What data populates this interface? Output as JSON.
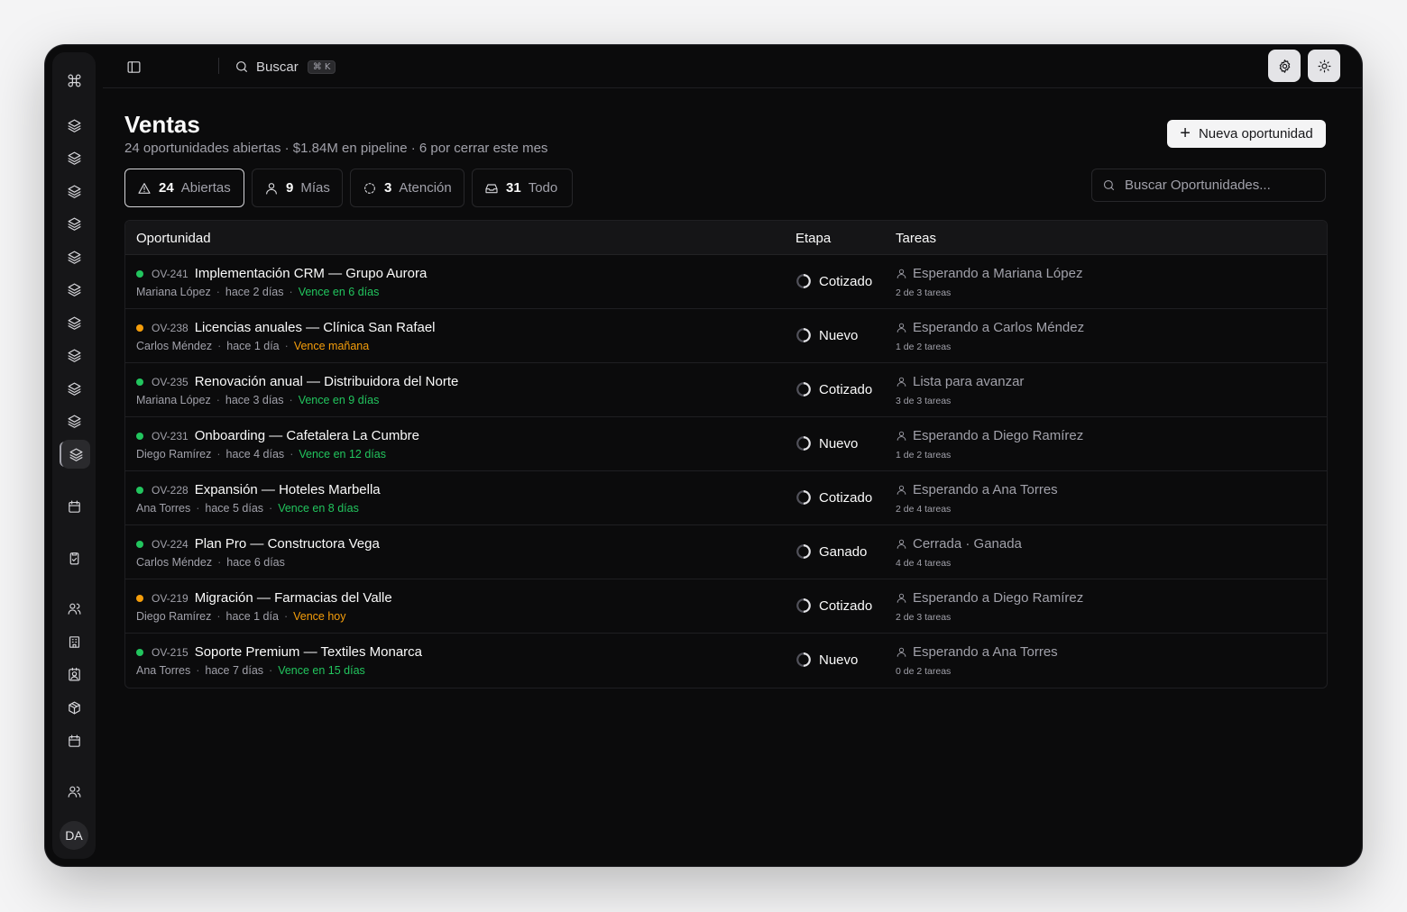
{
  "topbar": {
    "search_label": "Buscar",
    "search_shortcut": "⌘ K"
  },
  "sidebar": {
    "items": [
      {
        "icon": "command-icon"
      },
      {
        "icon": "layers-icon"
      },
      {
        "icon": "layers-icon"
      },
      {
        "icon": "layers-icon"
      },
      {
        "icon": "layers-icon"
      },
      {
        "icon": "layers-icon"
      },
      {
        "icon": "layers-icon"
      },
      {
        "icon": "layers-icon"
      },
      {
        "icon": "layers-icon"
      },
      {
        "icon": "layers-icon"
      },
      {
        "icon": "layers-icon"
      },
      {
        "icon": "layers-icon",
        "active": true
      },
      {
        "icon": "calendar-icon"
      },
      {
        "icon": "clipboard-check-icon"
      },
      {
        "icon": "users-icon"
      },
      {
        "icon": "building-icon"
      },
      {
        "icon": "contact-icon"
      },
      {
        "icon": "package-icon"
      },
      {
        "icon": "calendar-icon"
      },
      {
        "icon": "users-icon"
      }
    ],
    "avatar_initials": "DA"
  },
  "header": {
    "title": "Ventas",
    "subtitle": "24 oportunidades abiertas · $1.84M en pipeline · 6 por cerrar este mes",
    "new_button_label": "Nueva oportunidad"
  },
  "filters": [
    {
      "icon": "alert-triangle-icon",
      "count": "24",
      "label": "Abiertas",
      "active": true
    },
    {
      "icon": "user-icon",
      "count": "9",
      "label": "Mías",
      "active": false
    },
    {
      "icon": "dashed-circle-icon",
      "count": "3",
      "label": "Atención",
      "active": false
    },
    {
      "icon": "inbox-icon",
      "count": "31",
      "label": "Todo",
      "active": false
    }
  ],
  "search": {
    "placeholder": "Buscar Oportunidades..."
  },
  "table": {
    "columns": [
      "Oportunidad",
      "Etapa",
      "Tareas"
    ],
    "rows": [
      {
        "code": "OV-241",
        "title": "Implementación CRM — Grupo Aurora",
        "owner": "Mariana López",
        "ago": "hace 2 días",
        "due": "Vence en 6 días",
        "due_tone": "green",
        "dot": "#22c55e",
        "stage": "Cotizado",
        "task_status": "Esperando a Mariana López",
        "task_count": "2 de 3 tareas"
      },
      {
        "code": "OV-238",
        "title": "Licencias anuales — Clínica San Rafael",
        "owner": "Carlos Méndez",
        "ago": "hace 1 día",
        "due": "Vence mañana",
        "due_tone": "amber",
        "dot": "#f59e0b",
        "stage": "Nuevo",
        "task_status": "Esperando a Carlos Méndez",
        "task_count": "1 de 2 tareas"
      },
      {
        "code": "OV-235",
        "title": "Renovación anual — Distribuidora del Norte",
        "owner": "Mariana López",
        "ago": "hace 3 días",
        "due": "Vence en 9 días",
        "due_tone": "green",
        "dot": "#22c55e",
        "stage": "Cotizado",
        "task_status": "Lista para avanzar",
        "task_count": "3 de 3 tareas"
      },
      {
        "code": "OV-231",
        "title": "Onboarding — Cafetalera La Cumbre",
        "owner": "Diego Ramírez",
        "ago": "hace 4 días",
        "due": "Vence en 12 días",
        "due_tone": "green",
        "dot": "#22c55e",
        "stage": "Nuevo",
        "task_status": "Esperando a Diego Ramírez",
        "task_count": "1 de 2 tareas"
      },
      {
        "code": "OV-228",
        "title": "Expansión — Hoteles Marbella",
        "owner": "Ana Torres",
        "ago": "hace 5 días",
        "due": "Vence en 8 días",
        "due_tone": "green",
        "dot": "#22c55e",
        "stage": "Cotizado",
        "task_status": "Esperando a Ana Torres",
        "task_count": "2 de 4 tareas"
      },
      {
        "code": "OV-224",
        "title": "Plan Pro — Constructora Vega",
        "owner": "Carlos Méndez",
        "ago": "hace 6 días",
        "due": "",
        "due_tone": "none",
        "dot": "#22c55e",
        "stage": "Ganado",
        "task_status": "Cerrada · Ganada",
        "task_count": "4 de 4 tareas"
      },
      {
        "code": "OV-219",
        "title": "Migración — Farmacias del Valle",
        "owner": "Diego Ramírez",
        "ago": "hace 1 día",
        "due": "Vence hoy",
        "due_tone": "amber",
        "dot": "#f59e0b",
        "stage": "Cotizado",
        "task_status": "Esperando a Diego Ramírez",
        "task_count": "2 de 3 tareas"
      },
      {
        "code": "OV-215",
        "title": "Soporte Premium — Textiles Monarca",
        "owner": "Ana Torres",
        "ago": "hace 7 días",
        "due": "Vence en 15 días",
        "due_tone": "green",
        "dot": "#22c55e",
        "stage": "Nuevo",
        "task_status": "Esperando a Ana Torres",
        "task_count": "0 de 2 tareas"
      }
    ]
  }
}
